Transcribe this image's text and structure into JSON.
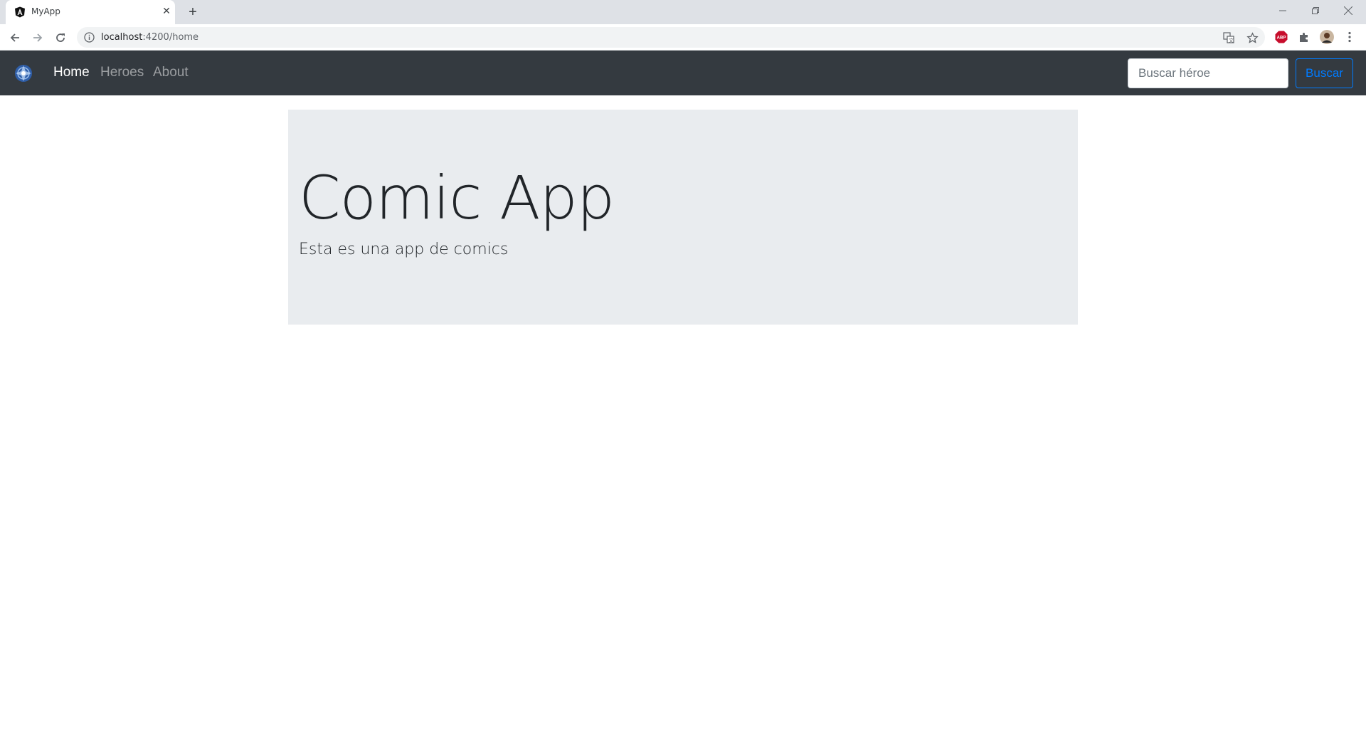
{
  "browser": {
    "tab_title": "MyApp",
    "url_host": "localhost",
    "url_path": ":4200/home"
  },
  "navbar": {
    "links": [
      {
        "label": "Home",
        "active": true
      },
      {
        "label": "Heroes",
        "active": false
      },
      {
        "label": "About",
        "active": false
      }
    ],
    "search_placeholder": "Buscar héroe",
    "search_button": "Buscar"
  },
  "jumbotron": {
    "title": "Comic App",
    "lead": "Esta es una app de comics"
  },
  "colors": {
    "navbar_bg": "#343a40",
    "jumbotron_bg": "#e9ecef",
    "primary": "#007bff"
  },
  "icons": {
    "tab_favicon": "angular-logo-icon",
    "brand": "app-logo-icon",
    "extension_1": "adblock-plus-icon",
    "extension_2": "puzzle-icon"
  }
}
